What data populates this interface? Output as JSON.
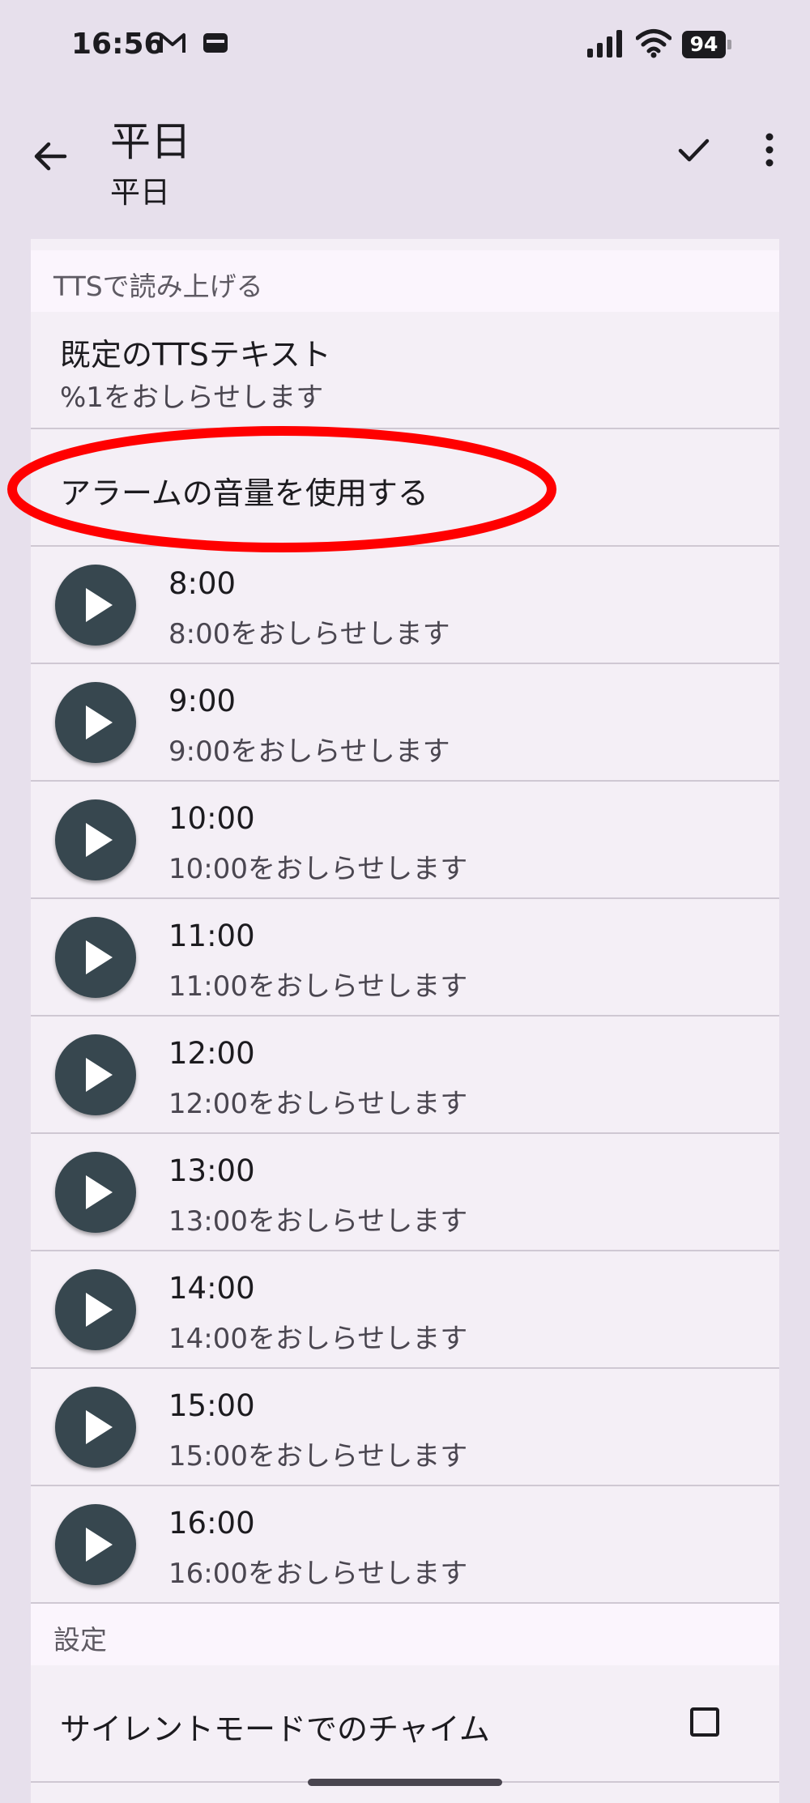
{
  "status_bar": {
    "time": "16:56",
    "battery": "94",
    "icons": [
      "gmail-icon",
      "card-icon",
      "signal-icon",
      "wifi-icon",
      "battery-icon"
    ]
  },
  "app_bar": {
    "title": "平日",
    "subtitle": "平日",
    "actions": [
      "back-arrow-icon",
      "check-icon",
      "more-vert-icon"
    ]
  },
  "tts_section": {
    "header": "TTSで読み上げる",
    "default_text_title": "既定のTTSテキスト",
    "default_text_value": "%1をおしらせします",
    "alarm_volume_label": "アラームの音量を使用する"
  },
  "chimes": [
    {
      "time": "8:00",
      "text": "8:00をおしらせします"
    },
    {
      "time": "9:00",
      "text": "9:00をおしらせします"
    },
    {
      "time": "10:00",
      "text": "10:00をおしらせします"
    },
    {
      "time": "11:00",
      "text": "11:00をおしらせします"
    },
    {
      "time": "12:00",
      "text": "12:00をおしらせします"
    },
    {
      "time": "13:00",
      "text": "13:00をおしらせします"
    },
    {
      "time": "14:00",
      "text": "14:00をおしらせします"
    },
    {
      "time": "15:00",
      "text": "15:00をおしらせします"
    },
    {
      "time": "16:00",
      "text": "16:00をおしらせします"
    }
  ],
  "settings_section": {
    "header": "設定",
    "silent_mode_label": "サイレントモードでのチャイム",
    "silent_mode_checked": false
  },
  "colors": {
    "background": "#e7e0ec",
    "panel": "#f4eff6",
    "play_button": "#37474f",
    "highlight": "#ff0000"
  }
}
